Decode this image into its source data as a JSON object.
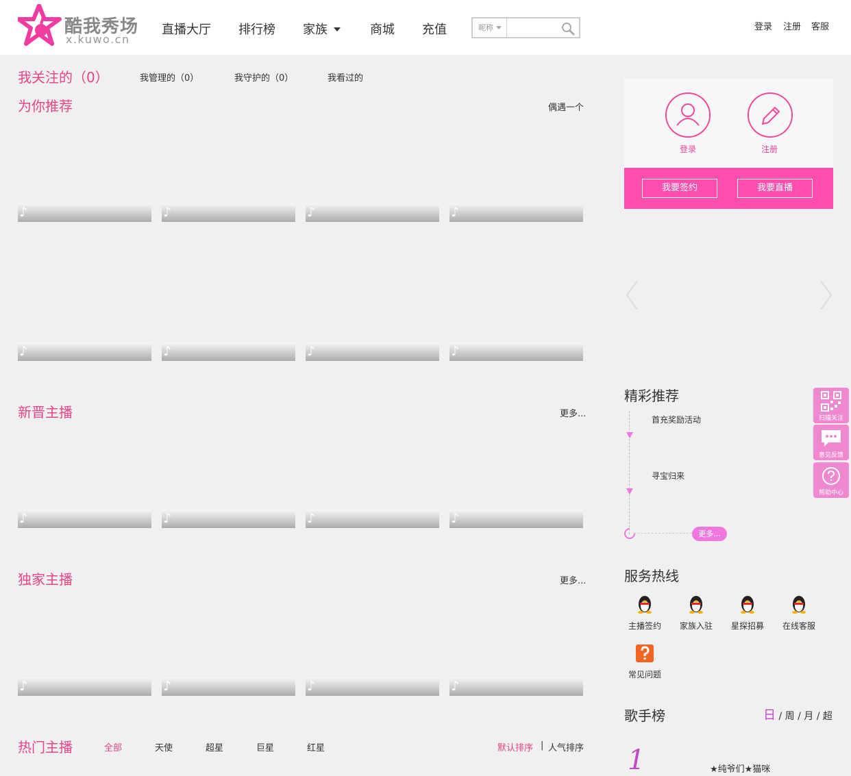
{
  "header": {
    "logo": {
      "cn": "酷我秀场",
      "url": "x.kuwo.cn"
    },
    "nav": [
      "直播大厅",
      "排行榜",
      "家族",
      "商城",
      "充值"
    ],
    "search": {
      "category": "昵称",
      "placeholder": ""
    },
    "top_links": [
      "登录",
      "注册",
      "客服"
    ]
  },
  "follow_tabs": {
    "following": "我关注的（0）",
    "managed": "我管理的（0）",
    "guarded": "我守护的（0）",
    "viewed": "我看过的"
  },
  "sections": {
    "recommend": {
      "title": "为你推荐",
      "action": "偶遇一个"
    },
    "newcomers": {
      "title": "新晋主播",
      "action": "更多..."
    },
    "exclusive": {
      "title": "独家主播",
      "action": "更多..."
    },
    "hot": {
      "title": "热门主播",
      "filters": [
        "全部",
        "天使",
        "超星",
        "巨星",
        "红星"
      ],
      "sort_default": "默认排序",
      "sort_sep": "|",
      "sort_popular": "人气排序"
    }
  },
  "thumb_icon": "♪",
  "user_card": {
    "login": "登录",
    "register": "注册",
    "sign_contract": "我要签约",
    "go_live": "我要直播"
  },
  "featured": {
    "title": "精彩推荐",
    "items": [
      "首充奖励活动",
      "寻宝归来"
    ],
    "more": "更多..."
  },
  "service": {
    "title": "服务热线",
    "items": [
      "主播签约",
      "家族入驻",
      "星探招募",
      "在线客服",
      "常见问题"
    ]
  },
  "singer_chart": {
    "title": "歌手榜",
    "periods": [
      "日",
      "周",
      "月",
      "超"
    ],
    "sep": "/",
    "rank": "1",
    "first": "★纯爷们★猫咪"
  },
  "float_bar": [
    "扫描关注",
    "意见反馈",
    "帮助中心"
  ],
  "colors": {
    "pink": "#e8448a",
    "bar": "#ff4fae",
    "accent": "#ee77e0"
  }
}
